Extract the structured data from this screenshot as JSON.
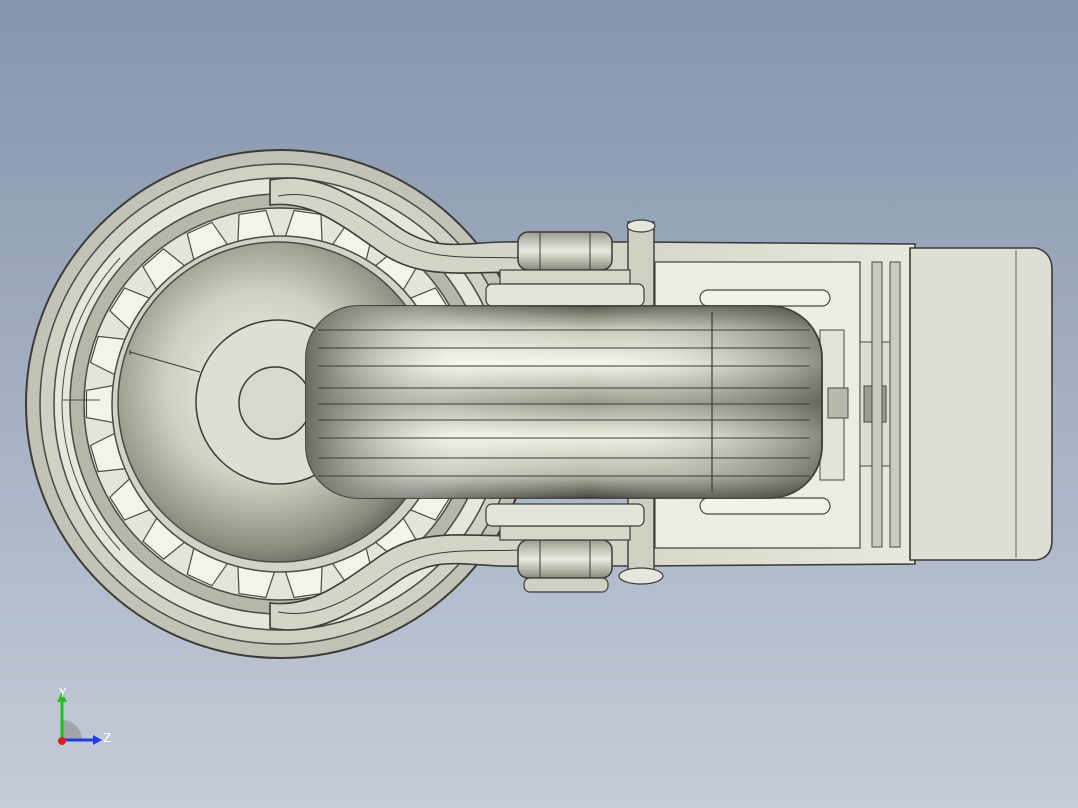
{
  "viewport": {
    "background_top": "#8595ad",
    "background_bottom": "#c6ccd8"
  },
  "model": {
    "metal_color": "#c9c9bd",
    "edge_color": "#3c3c36",
    "tread_color": "#d8d8cc"
  },
  "triad": {
    "y_label": "Y",
    "z_label": "Z",
    "y_color": "#22c020",
    "z_color": "#1f3cf0",
    "x_color": "#e02020"
  }
}
